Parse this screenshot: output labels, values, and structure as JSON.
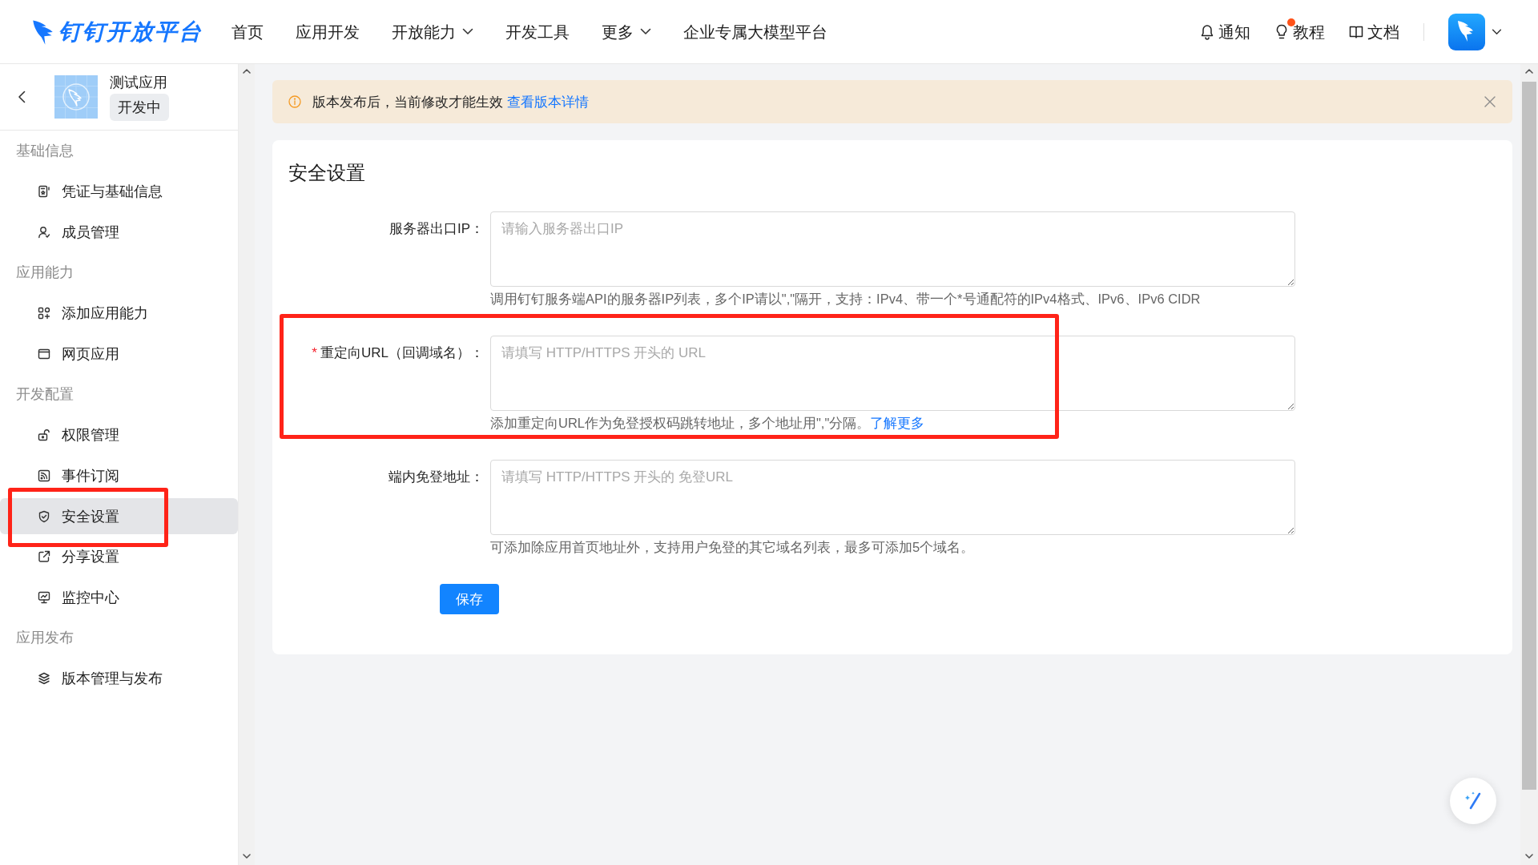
{
  "top_nav": {
    "logo": "钉钉开放平台",
    "menu": [
      {
        "label": "首页",
        "dropdown": false
      },
      {
        "label": "应用开发",
        "dropdown": false
      },
      {
        "label": "开放能力",
        "dropdown": true
      },
      {
        "label": "开发工具",
        "dropdown": false
      },
      {
        "label": "更多",
        "dropdown": true
      },
      {
        "label": "企业专属大模型平台",
        "dropdown": false
      }
    ],
    "actions": [
      {
        "kind": "bell",
        "label": "通知",
        "badge": false
      },
      {
        "kind": "bulb",
        "label": "教程",
        "badge": true
      },
      {
        "kind": "book",
        "label": "文档",
        "badge": false
      }
    ]
  },
  "sidebar": {
    "app": {
      "name": "测试应用",
      "status": "开发中"
    },
    "sections": [
      {
        "title": "基础信息",
        "items": [
          {
            "kind": "credential",
            "label": "凭证与基础信息",
            "selected": false,
            "highlighted": false
          },
          {
            "kind": "member",
            "label": "成员管理",
            "selected": false,
            "highlighted": false
          }
        ]
      },
      {
        "title": "应用能力",
        "items": [
          {
            "kind": "add-ability",
            "label": "添加应用能力",
            "selected": false,
            "highlighted": false
          },
          {
            "kind": "web",
            "label": "网页应用",
            "selected": false,
            "highlighted": false
          }
        ]
      },
      {
        "title": "开发配置",
        "items": [
          {
            "kind": "permission",
            "label": "权限管理",
            "selected": false,
            "highlighted": false
          },
          {
            "kind": "event",
            "label": "事件订阅",
            "selected": false,
            "highlighted": false
          },
          {
            "kind": "security",
            "label": "安全设置",
            "selected": true,
            "highlighted": true
          },
          {
            "kind": "share",
            "label": "分享设置",
            "selected": false,
            "highlighted": false
          },
          {
            "kind": "monitor",
            "label": "监控中心",
            "selected": false,
            "highlighted": false
          }
        ]
      },
      {
        "title": "应用发布",
        "items": [
          {
            "kind": "version",
            "label": "版本管理与发布",
            "selected": false,
            "highlighted": false
          }
        ]
      }
    ]
  },
  "notice": {
    "text": "版本发布后，当前修改才能生效",
    "link": "查看版本详情"
  },
  "form": {
    "title": "安全设置",
    "fields": [
      {
        "label": "服务器出口IP：",
        "placeholder": "请输入服务器出口IP",
        "help": "调用钉钉服务端API的服务器IP列表，多个IP请以\",\"隔开，支持：IPv4、带一个*号通配符的IPv4格式、IPv6、IPv6 CIDR",
        "highlighted": false
      },
      {
        "required_mark": "*",
        "label": "重定向URL（回调域名）：",
        "placeholder": "请填写 HTTP/HTTPS 开头的 URL",
        "help": "添加重定向URL作为免登授权码跳转地址，多个地址用\",\"分隔。",
        "help_link": "了解更多",
        "highlighted": true
      },
      {
        "label": "端内免登地址：",
        "placeholder": "请填写 HTTP/HTTPS 开头的 免登URL",
        "help": "可添加除应用首页地址外，支持用户免登的其它域名列表，最多可添加5个域名。",
        "highlighted": false
      }
    ],
    "submit": "保存"
  }
}
